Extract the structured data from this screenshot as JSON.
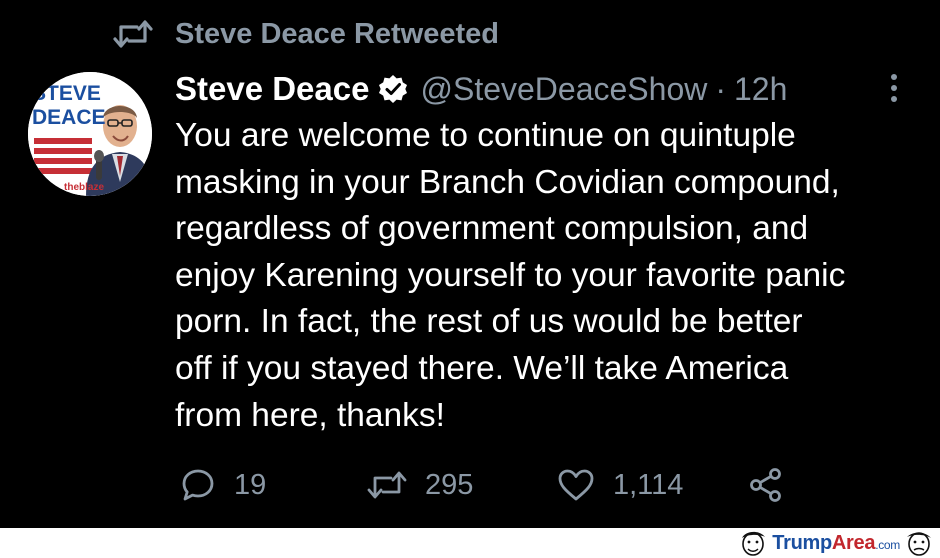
{
  "retweet_banner": {
    "text": "Steve Deace Retweeted",
    "icon": "retweet-icon"
  },
  "tweet": {
    "author_name": "Steve Deace",
    "verified": true,
    "handle": "@SteveDeaceShow",
    "separator": "·",
    "time": "12h",
    "body_lines": [
      "You are welcome to continue on quintuple",
      "masking in your Branch Covidian compound,",
      "regardless of government compulsion, and",
      "enjoy Karening yourself to your favorite panic",
      "porn. In fact, the rest of us would be better",
      "off if you stayed there. We’ll take America",
      "from here, thanks!"
    ],
    "avatar": {
      "line1": "STEVE",
      "line2": "DEACE",
      "brand": "theblaze"
    }
  },
  "actions": {
    "reply_count": "19",
    "retweet_count": "295",
    "like_count": "1,114"
  },
  "watermark": {
    "main": "Trump",
    "accent": "Area",
    "suffix": ".com"
  },
  "colors": {
    "background": "#000000",
    "text": "#ffffff",
    "muted": "#8b98a5"
  }
}
